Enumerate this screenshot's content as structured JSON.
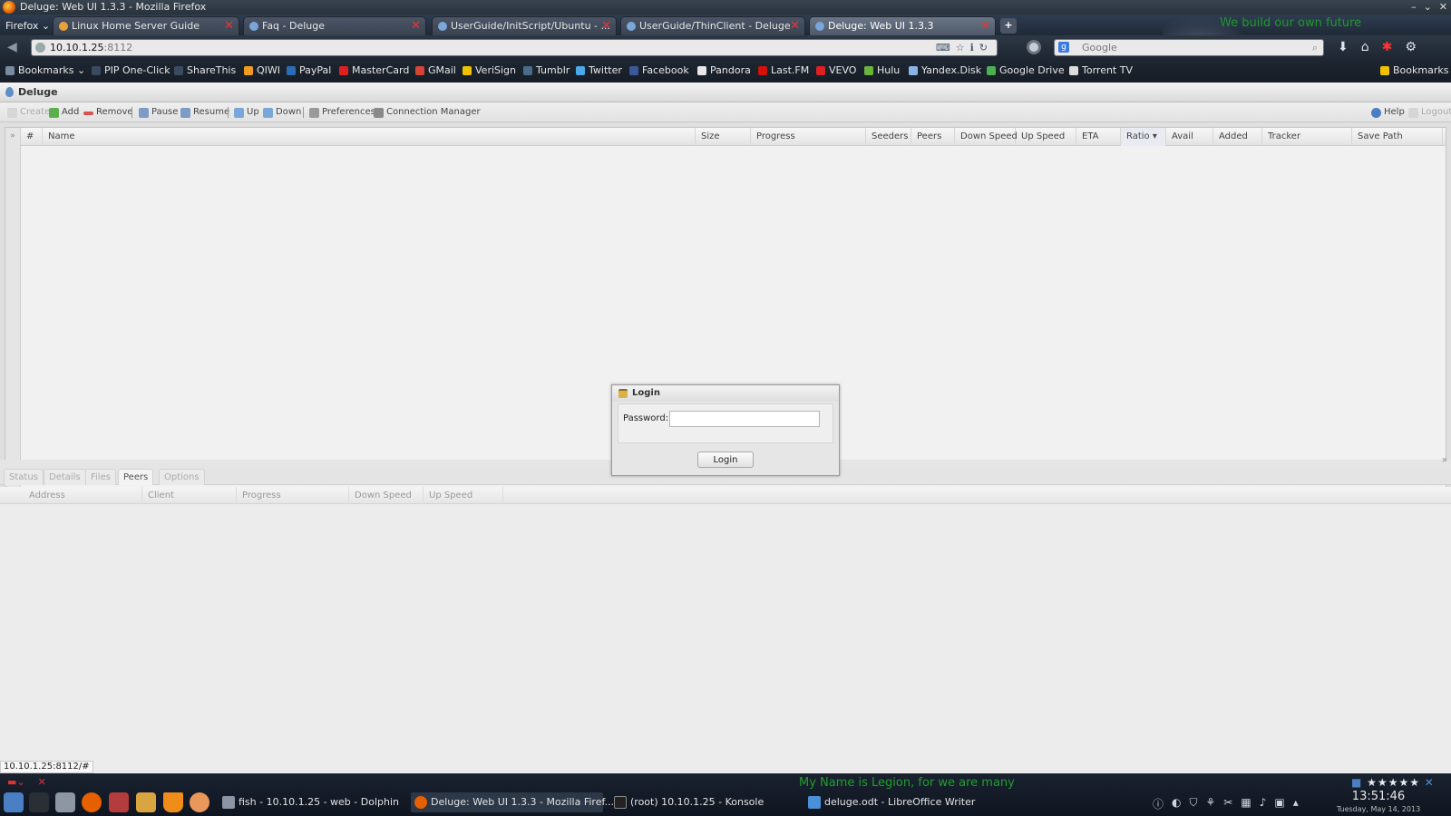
{
  "window": {
    "title": "Deluge: Web UI 1.3.3 - Mozilla Firefox"
  },
  "browser": {
    "menu_label": "Firefox",
    "tabs": [
      {
        "label": "Linux Home Server Guide"
      },
      {
        "label": "Faq - Deluge"
      },
      {
        "label": "UserGuide/InitScript/Ubuntu - ..."
      },
      {
        "label": "UserGuide/ThinClient - Deluge"
      },
      {
        "label": "Deluge: Web UI 1.3.3"
      }
    ],
    "tagline": "We build our own future",
    "url_host": "10.10.1.25",
    "url_port": ":8112",
    "search_placeholder": "Google",
    "bookmarks": [
      {
        "label": "Bookmarks",
        "color": "#7a8aa0"
      },
      {
        "label": "PIP One-Click",
        "color": "#3a4a60"
      },
      {
        "label": "ShareThis",
        "color": "#3a4a60"
      },
      {
        "label": "QIWI",
        "color": "#f29b1e"
      },
      {
        "label": "PayPal",
        "color": "#2b6db5"
      },
      {
        "label": "MasterCard",
        "color": "#e02020"
      },
      {
        "label": "GMail",
        "color": "#d64437"
      },
      {
        "label": "VeriSign",
        "color": "#f2c200"
      },
      {
        "label": "Tumblr",
        "color": "#4a6b8a"
      },
      {
        "label": "Twitter",
        "color": "#4aa9e9"
      },
      {
        "label": "Facebook",
        "color": "#3b5998"
      },
      {
        "label": "Pandora",
        "color": "#e8e8e8"
      },
      {
        "label": "Last.FM",
        "color": "#d51007"
      },
      {
        "label": "VEVO",
        "color": "#e02020"
      },
      {
        "label": "Hulu",
        "color": "#6cb33e"
      },
      {
        "label": "Yandex.Disk",
        "color": "#8ab4e8"
      },
      {
        "label": "Google Drive",
        "color": "#4caf50"
      },
      {
        "label": "Torrent TV",
        "color": "#dcdcdc"
      },
      {
        "label": "Bookmarks",
        "color": "#f2c200"
      }
    ]
  },
  "deluge": {
    "app_title": "Deluge",
    "toolbar": {
      "create": "Create",
      "add": "Add",
      "remove": "Remove",
      "pause": "Pause",
      "resume": "Resume",
      "up": "Up",
      "down": "Down",
      "preferences": "Preferences",
      "connection_manager": "Connection Manager",
      "help": "Help",
      "logout": "Logout"
    },
    "columns": [
      "#",
      "Name",
      "Size",
      "Progress",
      "Seeders",
      "Peers",
      "Down Speed",
      "Up Speed",
      "ETA",
      "Ratio",
      "Avail",
      "Added",
      "Tracker",
      "Save Path"
    ],
    "sorted_column_indicator": "▾",
    "detail_tabs": [
      {
        "label": "Status"
      },
      {
        "label": "Details"
      },
      {
        "label": "Files"
      },
      {
        "label": "Peers"
      },
      {
        "label": "Options"
      }
    ],
    "peers_columns": [
      "Address",
      "Client",
      "Progress",
      "Down Speed",
      "Up Speed"
    ],
    "login": {
      "title": "Login",
      "password_label": "Password:",
      "password_value": "",
      "button_label": "Login"
    }
  },
  "status_url": "10.10.1.25:8112/#",
  "desktop": {
    "motto": "My Name is Legion, for we are many",
    "stars": "★★★★★",
    "taskbar": [
      {
        "label": "fish - 10.10.1.25 - web - Dolphin",
        "color": "#8a95a5"
      },
      {
        "label": "Deluge: Web UI 1.3.3 - Mozilla Firef...",
        "color": "#e66000"
      },
      {
        "label": "(root) 10.10.1.25 - Konsole",
        "color": "#222"
      },
      {
        "label": "deluge.odt - LibreOffice Writer",
        "color": "#4a90d9"
      }
    ],
    "clock_time": "13:51:46",
    "clock_date": "Tuesday, May 14, 2013"
  }
}
